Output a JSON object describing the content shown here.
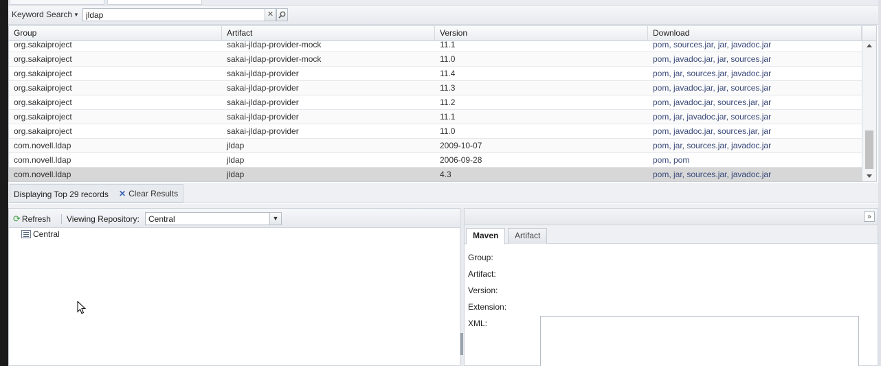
{
  "search": {
    "mode_label": "Keyword Search",
    "query": "jldap"
  },
  "grid": {
    "columns": [
      "Group",
      "Artifact",
      "Version",
      "Download"
    ],
    "rows": [
      {
        "group": "org.sakaiproject",
        "artifact": "sakai-jldap-provider-mock",
        "version": "11.1",
        "download": "pom, sources.jar, jar, javadoc.jar"
      },
      {
        "group": "org.sakaiproject",
        "artifact": "sakai-jldap-provider-mock",
        "version": "11.0",
        "download": "pom, javadoc.jar, jar, sources.jar"
      },
      {
        "group": "org.sakaiproject",
        "artifact": "sakai-jldap-provider",
        "version": "11.4",
        "download": "pom, jar, sources.jar, javadoc.jar"
      },
      {
        "group": "org.sakaiproject",
        "artifact": "sakai-jldap-provider",
        "version": "11.3",
        "download": "pom, javadoc.jar, jar, sources.jar"
      },
      {
        "group": "org.sakaiproject",
        "artifact": "sakai-jldap-provider",
        "version": "11.2",
        "download": "pom, javadoc.jar, sources.jar, jar"
      },
      {
        "group": "org.sakaiproject",
        "artifact": "sakai-jldap-provider",
        "version": "11.1",
        "download": "pom, jar, javadoc.jar, sources.jar"
      },
      {
        "group": "org.sakaiproject",
        "artifact": "sakai-jldap-provider",
        "version": "11.0",
        "download": "pom, javadoc.jar, sources.jar, jar"
      },
      {
        "group": "com.novell.ldap",
        "artifact": "jldap",
        "version": "2009-10-07",
        "download": "pom, jar, sources.jar, javadoc.jar"
      },
      {
        "group": "com.novell.ldap",
        "artifact": "jldap",
        "version": "2006-09-28",
        "download": "pom, pom"
      },
      {
        "group": "com.novell.ldap",
        "artifact": "jldap",
        "version": "4.3",
        "download": "pom, jar, sources.jar, javadoc.jar",
        "selected": true
      }
    ]
  },
  "status": {
    "text": "Displaying Top 29 records",
    "clear_label": "Clear Results"
  },
  "browser": {
    "refresh_label": "Refresh",
    "viewing_label": "Viewing Repository:",
    "repository": "Central",
    "tree_root": "Central"
  },
  "details": {
    "tabs": [
      "Maven",
      "Artifact"
    ],
    "labels": {
      "group": "Group:",
      "artifact": "Artifact:",
      "version": "Version:",
      "extension": "Extension:",
      "xml": "XML:"
    }
  }
}
